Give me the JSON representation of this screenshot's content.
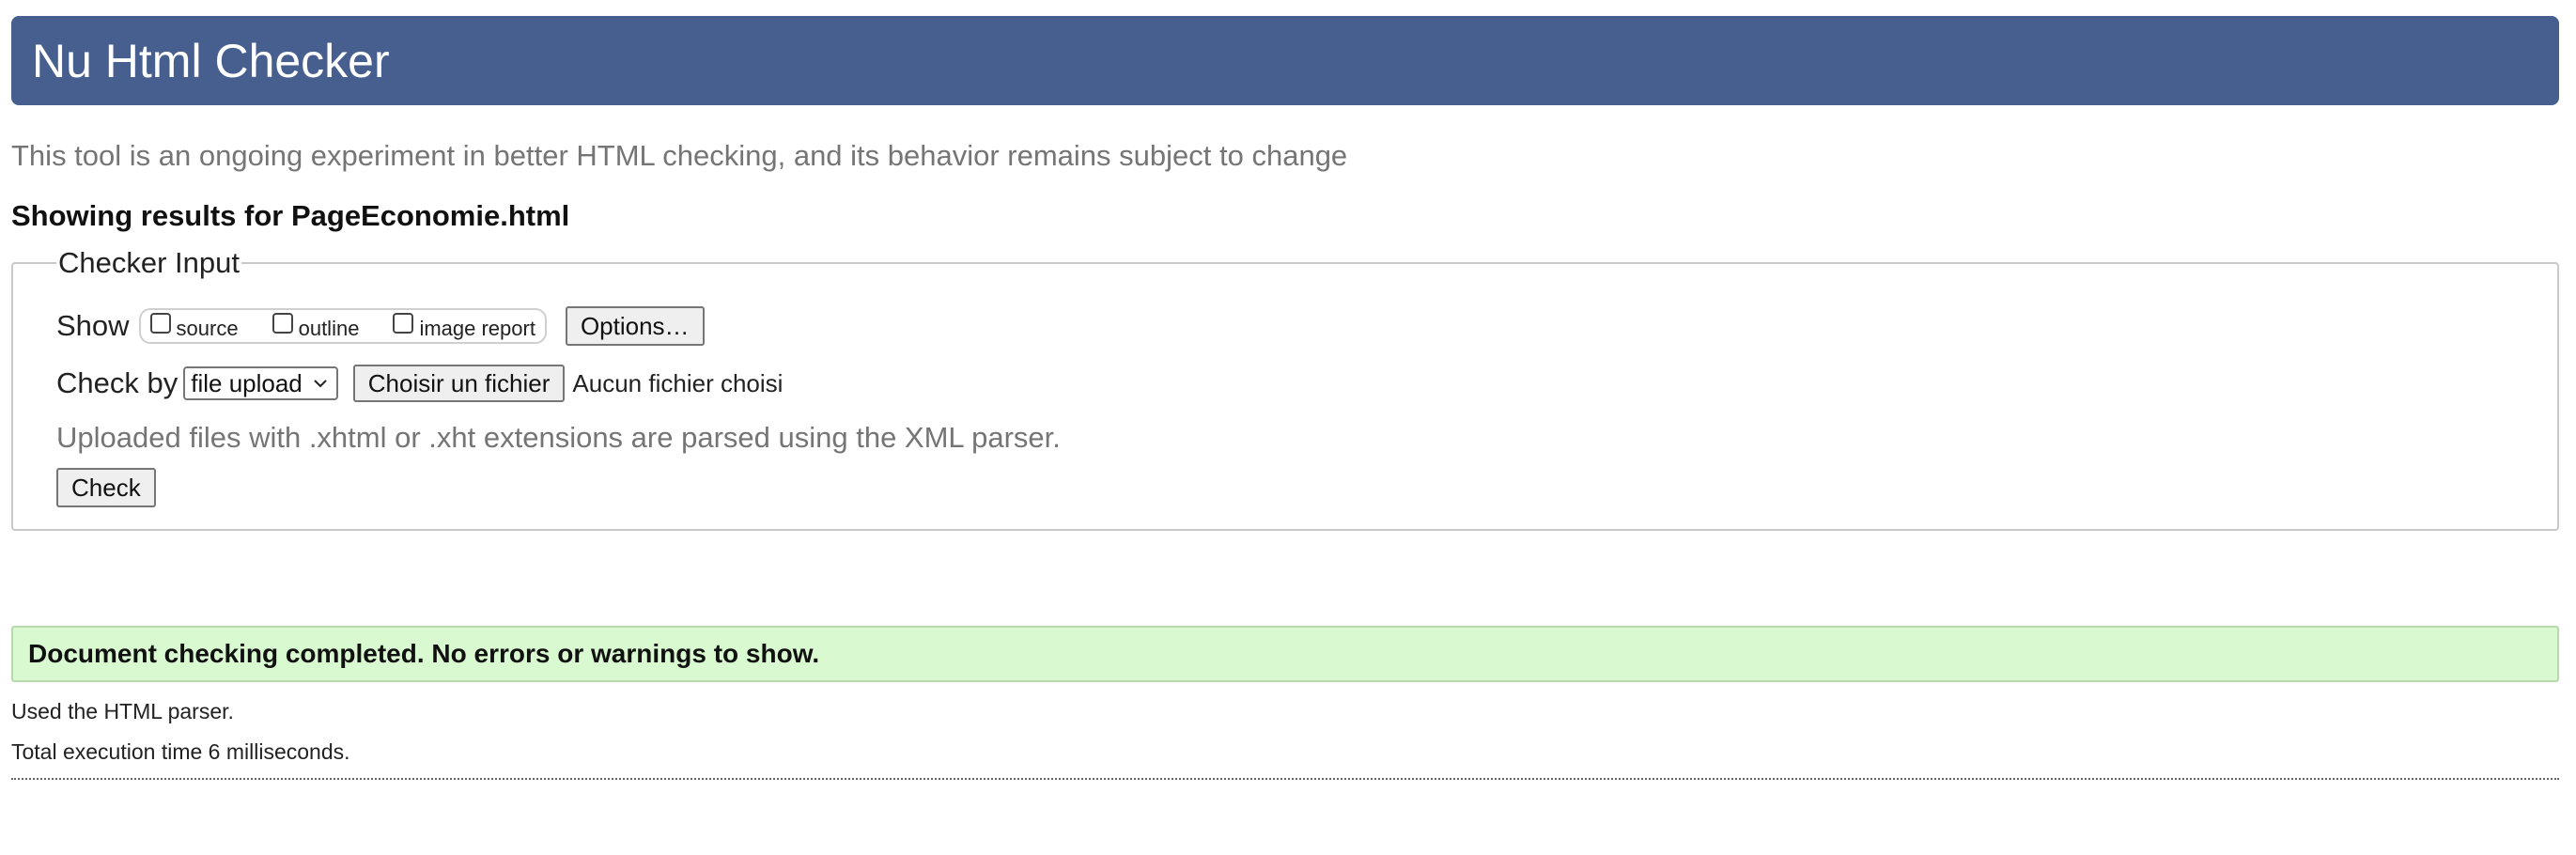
{
  "header": {
    "title": "Nu Html Checker"
  },
  "tagline": "This tool is an ongoing experiment in better HTML checking, and its behavior remains subject to change",
  "results_heading": "Showing results for PageEconomie.html",
  "checker_input": {
    "legend": "Checker Input",
    "show_label": "Show",
    "show_options": [
      {
        "label": "source",
        "checked": false
      },
      {
        "label": "outline",
        "checked": false
      },
      {
        "label": "image report",
        "checked": false
      }
    ],
    "options_button": "Options…",
    "check_by_label": "Check by",
    "check_by_selected": "file upload",
    "choose_file_button": "Choisir un fichier",
    "file_status": "Aucun fichier choisi",
    "upload_note": "Uploaded files with .xhtml or .xht extensions are parsed using the XML parser.",
    "check_button": "Check"
  },
  "result": {
    "message": "Document checking completed. No errors or warnings to show.",
    "parser_note": "Used the HTML parser.",
    "time_note": "Total execution time 6 milliseconds."
  },
  "colors": {
    "banner": "#465f8f",
    "success_bg": "#d9f9d1",
    "muted_text": "#757575"
  },
  "icons": {
    "select_arrow": "chevron-down-icon"
  }
}
